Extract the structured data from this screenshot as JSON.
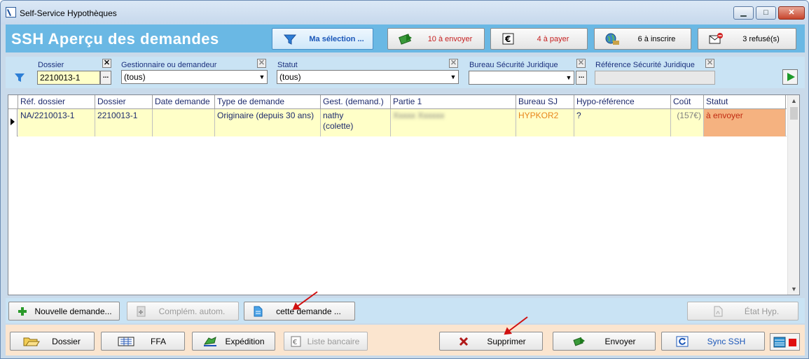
{
  "window": {
    "title": "Self-Service Hypothèques",
    "controls": {
      "minimize": "▁",
      "maximize": "□",
      "close": "✕"
    }
  },
  "header": {
    "title": "SSH  Aperçu des demandes",
    "buttons": [
      {
        "id": "ma-selection",
        "label": "Ma sélection ...",
        "icon": "filter-icon",
        "selected": true
      },
      {
        "id": "a-envoyer",
        "label": "10 à envoyer",
        "icon": "send-money-icon",
        "color": "#c62020"
      },
      {
        "id": "a-payer",
        "label": "4 à payer",
        "icon": "euro-icon",
        "color": "#c62020"
      },
      {
        "id": "a-inscrire",
        "label": "6 à inscrire",
        "icon": "globe-icon"
      },
      {
        "id": "refuses",
        "label": "3 refusé(s)",
        "icon": "envelope-refused-icon"
      }
    ]
  },
  "filters": {
    "dossier": {
      "label": "Dossier",
      "value": "2210013-1",
      "clear": "✕",
      "more": "..."
    },
    "gestionnaire": {
      "label": "Gestionnaire ou demandeur",
      "value": "(tous)",
      "clear": "✕"
    },
    "statut": {
      "label": "Statut",
      "value": "(tous)",
      "clear": "✕"
    },
    "bureau": {
      "label": "Bureau Sécurité Juridique",
      "value": "",
      "clear": "✕",
      "more": "..."
    },
    "reference": {
      "label": "Référence Sécurité Juridique",
      "value": "",
      "clear": "✕"
    },
    "dropdown_arrow": "▼"
  },
  "grid": {
    "columns": [
      "Réf. dossier",
      "Dossier",
      "Date demande",
      "Type de demande",
      "Gest. (demand.)",
      "Partie 1",
      "Bureau SJ",
      "Hypo-référence",
      "Coût",
      "Statut"
    ],
    "rows": [
      {
        "ref": "NA/2210013-1",
        "dossier": "2210013-1",
        "date": "",
        "type": "Originaire (depuis 30 ans)",
        "gest": "nathy",
        "gest2": "(colette)",
        "partie": "Xxxxx Xxxxxx",
        "bureau": "HYPKOR2",
        "hypo": "?",
        "cout": "(157€)",
        "statut": "à envoyer",
        "colors": {
          "bureau": "#e8851c",
          "statut_bg": "#f5b280",
          "statut_text": "#c02a10",
          "cout": "#808080"
        }
      }
    ],
    "scroll": {
      "up": "▲",
      "down": "▼"
    }
  },
  "actions": {
    "nouvelle": "Nouvelle demande...",
    "complem": "Complém. autom.",
    "cette": "cette demande ...",
    "etat": "État Hyp."
  },
  "footer": {
    "dossier": "Dossier",
    "ffa": "FFA",
    "expedition": "Expédition",
    "liste": "Liste bancaire",
    "supprimer": "Supprimer",
    "envoyer": "Envoyer",
    "sync": "Sync SSH"
  },
  "colors": {
    "accent": "#6ab8e4",
    "filter_bg": "#c9e3f4",
    "footer_bg": "#fbe5cf",
    "row_bg": "#ffffc8",
    "annotation_arrow": "#d01010"
  }
}
